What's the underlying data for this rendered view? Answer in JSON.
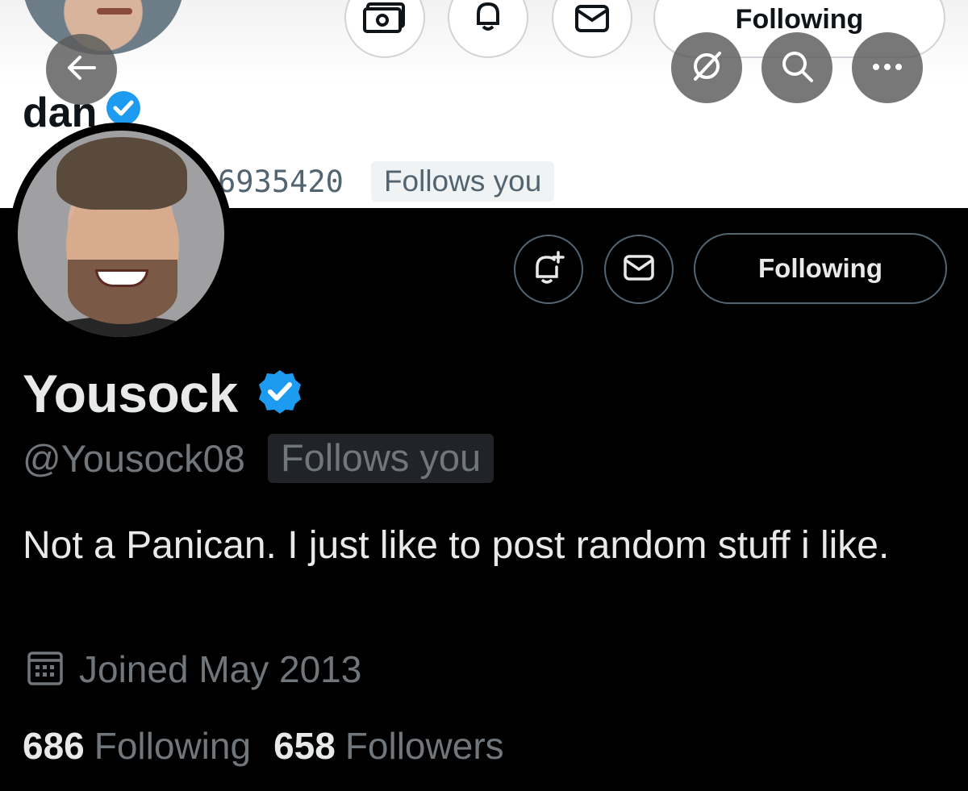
{
  "background_profile": {
    "name_partial": "dan",
    "handle_partial": "6935420",
    "follows_you_label": "Follows you",
    "following_label": "Following"
  },
  "nav": {
    "back_icon": "arrow-left-icon",
    "grok_icon": "grok-icon",
    "search_icon": "search-icon",
    "more_icon": "more-horizontal-icon"
  },
  "profile": {
    "display_name": "Yousock",
    "handle": "@Yousock08",
    "follows_you_label": "Follows you",
    "bio": "Not a Panican. I just like to post random stuff i like.",
    "joined": "Joined May 2013",
    "following_count": "686",
    "following_label": "Following",
    "followers_count": "658",
    "followers_label": "Followers",
    "verified_color": "#1d9bf0"
  },
  "actions": {
    "following_button_label": "Following",
    "notify_icon": "bell-plus-icon",
    "message_icon": "mail-icon"
  },
  "colors": {
    "background": "#000000",
    "primary_text": "#e7e9ea",
    "secondary_text": "#71767b",
    "border": "#536471",
    "accent": "#1d9bf0"
  }
}
